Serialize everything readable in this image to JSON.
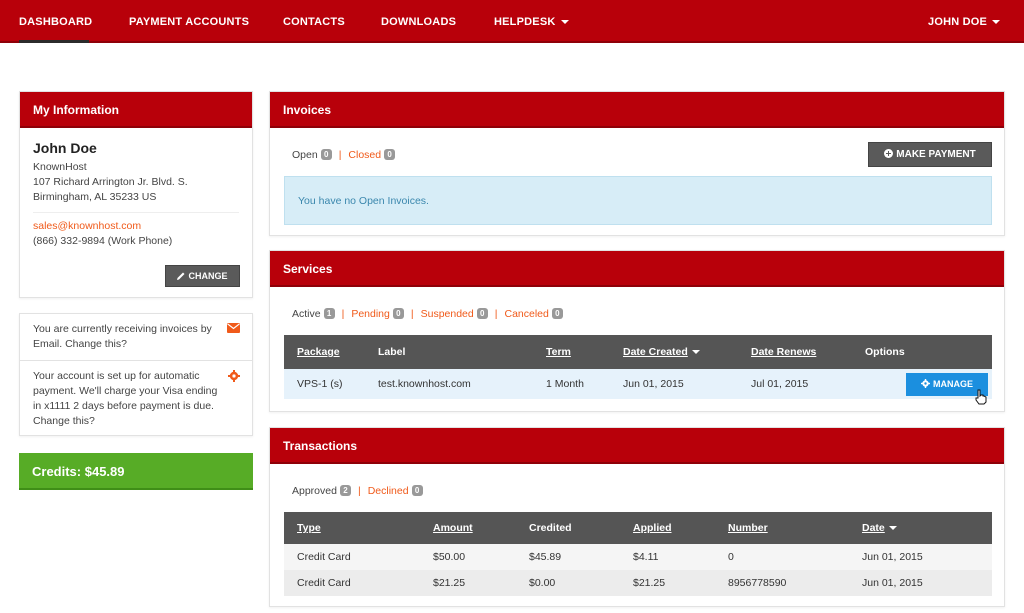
{
  "nav": {
    "items": [
      "DASHBOARD",
      "PAYMENT ACCOUNTS",
      "CONTACTS",
      "DOWNLOADS",
      "HELPDESK"
    ],
    "user": "JOHN DOE"
  },
  "info": {
    "title": "My Information",
    "name": "John Doe",
    "company": "KnownHost",
    "address1": "107 Richard Arrington Jr. Blvd. S.",
    "address2": "Birmingham, AL 35233 US",
    "email": "sales@knownhost.com",
    "phone": "(866) 332-9894 (Work Phone)",
    "change_label": "CHANGE"
  },
  "notices": [
    "You are currently receiving invoices by Email. Change this?",
    "Your account is set up for automatic payment. We'll charge your Visa ending in x1111 2 days before payment is due. Change this?"
  ],
  "credits": "Credits: $45.89",
  "invoices": {
    "title": "Invoices",
    "filters": [
      {
        "label": "Open",
        "count": "0"
      },
      {
        "label": "Closed",
        "count": "0"
      }
    ],
    "make_payment_label": "MAKE PAYMENT",
    "empty_message": "You have no Open Invoices."
  },
  "services": {
    "title": "Services",
    "filters": [
      {
        "label": "Active",
        "count": "1"
      },
      {
        "label": "Pending",
        "count": "0"
      },
      {
        "label": "Suspended",
        "count": "0"
      },
      {
        "label": "Canceled",
        "count": "0"
      }
    ],
    "columns": [
      "Package",
      "Label",
      "Term",
      "Date Created",
      "Date Renews",
      "Options"
    ],
    "rows": [
      {
        "package": "VPS-1 (s)",
        "label": "test.knownhost.com",
        "term": "1 Month",
        "created": "Jun 01, 2015",
        "renews": "Jul 01, 2015"
      }
    ],
    "manage_label": "MANAGE"
  },
  "transactions": {
    "title": "Transactions",
    "filters": [
      {
        "label": "Approved",
        "count": "2"
      },
      {
        "label": "Declined",
        "count": "0"
      }
    ],
    "columns": [
      "Type",
      "Amount",
      "Credited",
      "Applied",
      "Number",
      "Date"
    ],
    "rows": [
      {
        "type": "Credit Card",
        "amount": "$50.00",
        "credited": "$45.89",
        "applied": "$4.11",
        "number": "0",
        "date": "Jun 01, 2015"
      },
      {
        "type": "Credit Card",
        "amount": "$21.25",
        "credited": "$0.00",
        "applied": "$21.25",
        "number": "8956778590",
        "date": "Jun 01, 2015"
      }
    ]
  },
  "colors": {
    "brand_red": "#b8000a",
    "accent_orange": "#f05a1a",
    "credits_green": "#57ac26",
    "manage_blue": "#1b8fdf"
  }
}
